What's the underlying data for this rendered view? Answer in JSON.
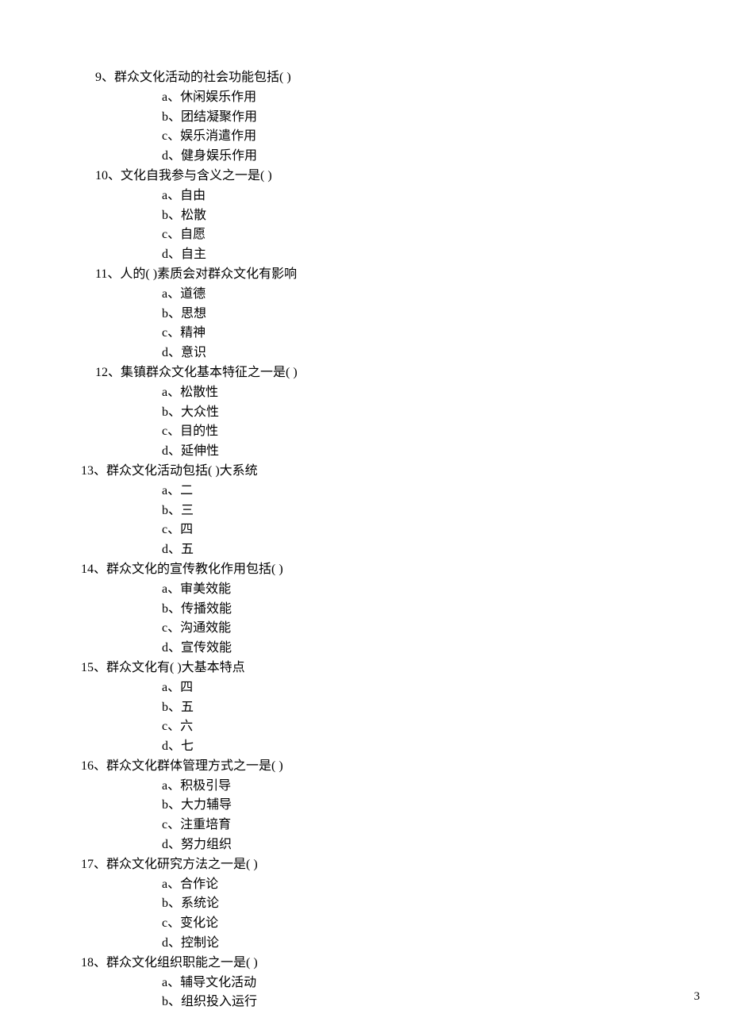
{
  "page_number": "3",
  "questions": [
    {
      "num": "9、",
      "text": "群众文化活动的社会功能包括(      )",
      "indent": "indent-1",
      "options": [
        {
          "letter": "a、",
          "text": "休闲娱乐作用"
        },
        {
          "letter": "b、",
          "text": "团结凝聚作用"
        },
        {
          "letter": "c、",
          "text": "娱乐消遣作用"
        },
        {
          "letter": "d、",
          "text": "健身娱乐作用"
        }
      ]
    },
    {
      "num": "10、",
      "text": "文化自我参与含义之一是(      )",
      "indent": "indent-1",
      "options": [
        {
          "letter": "a、",
          "text": "自由"
        },
        {
          "letter": "b、",
          "text": "松散"
        },
        {
          "letter": "c、",
          "text": "自愿"
        },
        {
          "letter": "d、",
          "text": "自主"
        }
      ]
    },
    {
      "num": "11、",
      "text": "人的(      )素质会对群众文化有影响",
      "indent": "indent-1",
      "options": [
        {
          "letter": "a、",
          "text": "道德"
        },
        {
          "letter": "b、",
          "text": "思想"
        },
        {
          "letter": "c、",
          "text": "精神"
        },
        {
          "letter": "d、",
          "text": "意识"
        }
      ]
    },
    {
      "num": "12、",
      "text": "集镇群众文化基本特征之一是(       )",
      "indent": "indent-1",
      "options": [
        {
          "letter": "a、",
          "text": "松散性"
        },
        {
          "letter": "b、",
          "text": "大众性"
        },
        {
          "letter": "c、",
          "text": "目的性"
        },
        {
          "letter": "d、",
          "text": "延伸性"
        }
      ]
    },
    {
      "num": "13、",
      "text": "群众文化活动包括(       )大系统",
      "indent": "indent-2",
      "options": [
        {
          "letter": "a、",
          "text": "二"
        },
        {
          "letter": "b、",
          "text": "三"
        },
        {
          "letter": "c、",
          "text": "四"
        },
        {
          "letter": "d、",
          "text": "五"
        }
      ]
    },
    {
      "num": "14、",
      "text": "群众文化的宣传教化作用包括(       )",
      "indent": "indent-2",
      "options": [
        {
          "letter": "a、",
          "text": "审美效能"
        },
        {
          "letter": "b、",
          "text": "传播效能"
        },
        {
          "letter": "c、",
          "text": "沟通效能"
        },
        {
          "letter": "d、",
          "text": "宣传效能"
        }
      ]
    },
    {
      "num": "15、",
      "text": "群众文化有(       )大基本特点",
      "indent": "indent-2",
      "options": [
        {
          "letter": "a、",
          "text": "四"
        },
        {
          "letter": "b、",
          "text": "五"
        },
        {
          "letter": "c、",
          "text": "六"
        },
        {
          "letter": "d、",
          "text": "七"
        }
      ]
    },
    {
      "num": "16、",
      "text": "群众文化群体管理方式之一是(       )",
      "indent": "indent-2",
      "options": [
        {
          "letter": "a、",
          "text": "积极引导"
        },
        {
          "letter": "b、",
          "text": "大力辅导"
        },
        {
          "letter": "c、",
          "text": "注重培育"
        },
        {
          "letter": "d、",
          "text": "努力组织"
        }
      ]
    },
    {
      "num": "17、",
      "text": "群众文化研究方法之一是(       )",
      "indent": "indent-2",
      "options": [
        {
          "letter": "a、",
          "text": "合作论"
        },
        {
          "letter": "b、",
          "text": "系统论"
        },
        {
          "letter": "c、",
          "text": "变化论"
        },
        {
          "letter": "d、",
          "text": "控制论"
        }
      ]
    },
    {
      "num": "18、",
      "text": "群众文化组织职能之一是(       )",
      "indent": "indent-2",
      "options": [
        {
          "letter": "a、",
          "text": "辅导文化活动"
        },
        {
          "letter": "b、",
          "text": "组织投入运行"
        }
      ]
    }
  ]
}
